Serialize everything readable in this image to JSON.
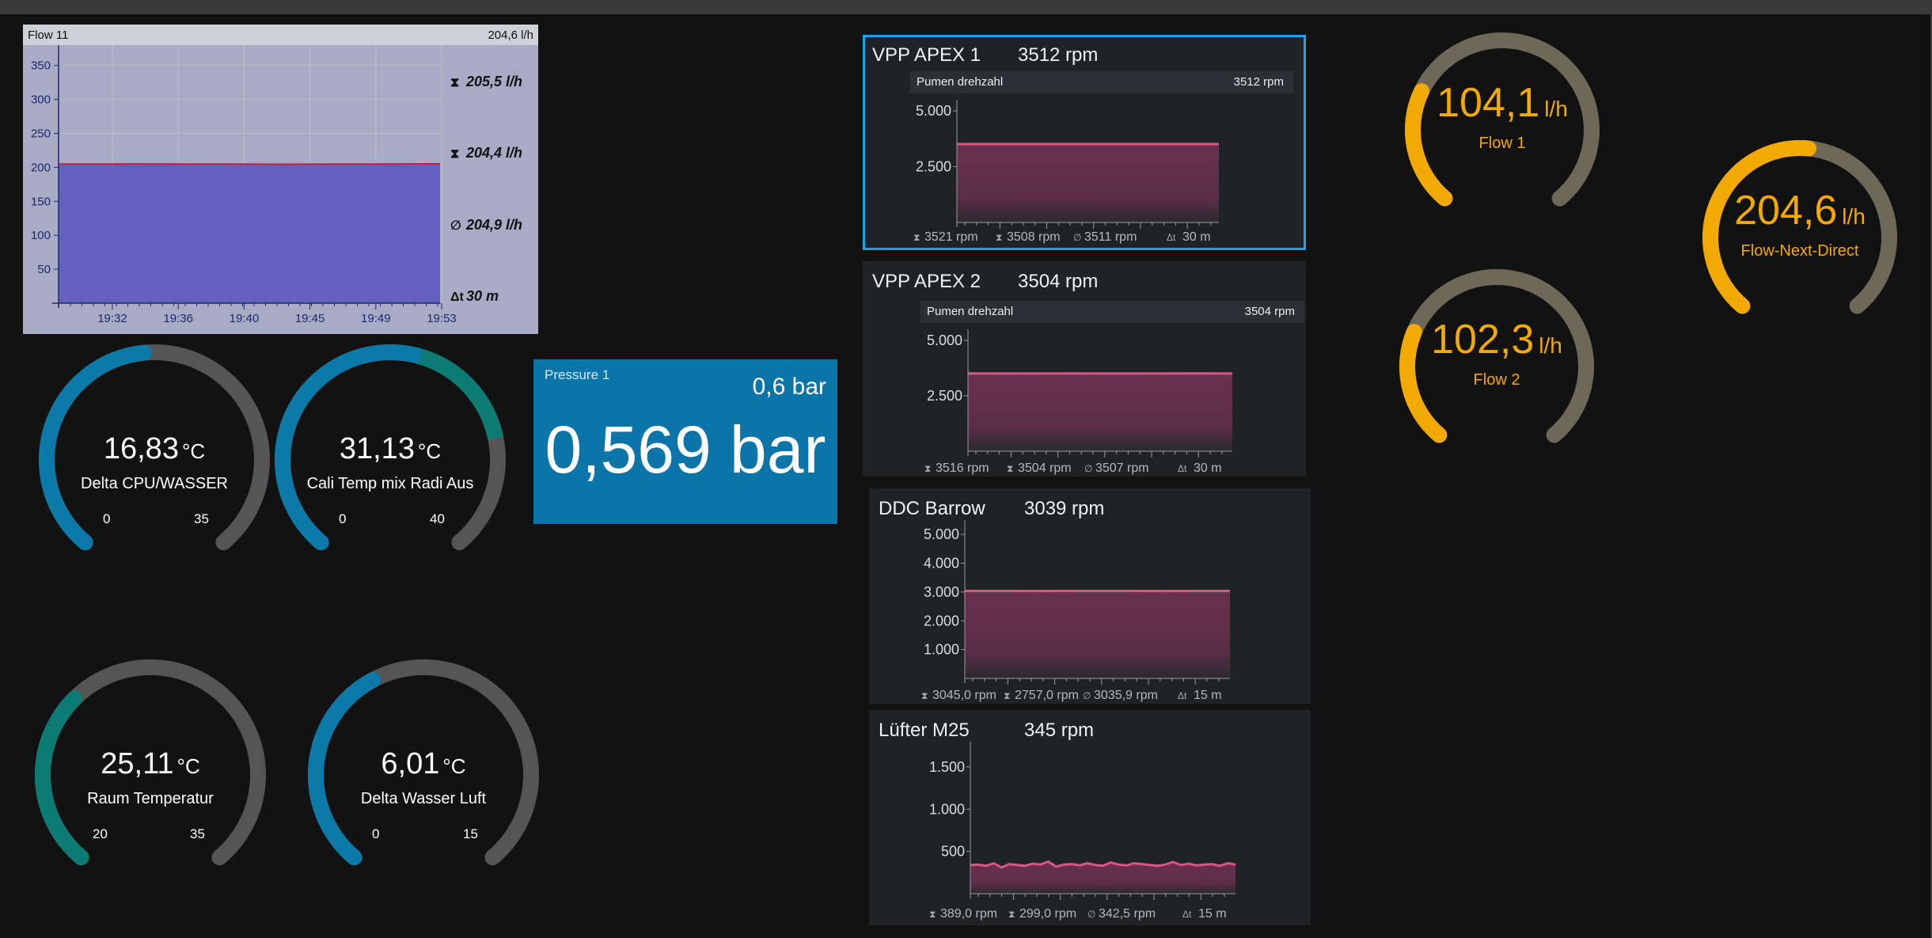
{
  "colors": {
    "background": "#121212",
    "track": "#555555",
    "teal": "#0b7b74",
    "blue": "#0b7aa8",
    "orange": "#f2a900",
    "flow_track": "#6e6858",
    "rpm_line": "#d9577f",
    "selected_outline": "#1aa3e8"
  },
  "flow11": {
    "title": "Flow 11",
    "current": "204,6 l/h",
    "max": "205,5 l/h",
    "min": "204,4 l/h",
    "avg": "204,9 l/h",
    "range": "30 m",
    "stat_icons": [
      "max-arrow-icon",
      "min-arrow-icon",
      "average-icon",
      "delta-time-icon"
    ],
    "chart_data": {
      "type": "area",
      "x": [
        "19:32",
        "19:36",
        "19:40",
        "19:45",
        "19:49",
        "19:53"
      ],
      "values": [
        204.8,
        205.0,
        204.9,
        204.6,
        204.9,
        205.1
      ],
      "yticks": [
        "50",
        "100",
        "150",
        "200",
        "250",
        "300",
        "350"
      ],
      "ylim": [
        0,
        380
      ]
    }
  },
  "gauges": [
    {
      "value": "16,83",
      "unit": "°C",
      "label": "Delta CPU/WASSER",
      "min": "0",
      "max": "35",
      "fraction": 0.48,
      "color": "#0b7aa8"
    },
    {
      "value": "31,13",
      "unit": "°C",
      "label": "Cali  Temp mix Radi Aus",
      "min": "0",
      "max": "40",
      "fraction": 0.78,
      "color": "#0b7aa8",
      "color2": "#0b7b74"
    },
    {
      "value": "25,11",
      "unit": "°C",
      "label": "Raum Temperatur",
      "min": "20",
      "max": "35",
      "fraction": 0.34,
      "color": "#0b7b74"
    },
    {
      "value": "6,01",
      "unit": "°C",
      "label": "Delta Wasser Luft",
      "min": "0",
      "max": "15",
      "fraction": 0.4,
      "color": "#0b7aa8"
    }
  ],
  "pressure": {
    "title": "Pressure 1",
    "setpoint": "0,6 bar",
    "value": "0,569 bar"
  },
  "rpm_panels": [
    {
      "title": "VPP APEX 1",
      "value": "3512 rpm",
      "sub_label": "Pumen drehzahl",
      "sub_value": "3512 rpm",
      "stats": [
        "3521 rpm",
        "3508 rpm",
        "3511 rpm",
        "30 m"
      ],
      "chart_data": {
        "type": "area",
        "yticks": [
          "2.500",
          "5.000"
        ],
        "ylim": [
          0,
          5500
        ],
        "values": [
          3512,
          3512,
          3512,
          3512
        ]
      }
    },
    {
      "title": "VPP APEX 2",
      "value": "3504 rpm",
      "sub_label": "Pumen drehzahl",
      "sub_value": "3504 rpm",
      "stats": [
        "3516 rpm",
        "3504 rpm",
        "3507 rpm",
        "30 m"
      ],
      "chart_data": {
        "type": "area",
        "yticks": [
          "2.500",
          "5.000"
        ],
        "ylim": [
          0,
          5500
        ],
        "values": [
          3507,
          3505,
          3509,
          3504,
          3508,
          3506
        ]
      }
    },
    {
      "title": "DDC Barrow",
      "value": "3039 rpm",
      "stats": [
        "3045,0 rpm",
        "2757,0 rpm",
        "3035,9 rpm",
        "15 m"
      ],
      "chart_data": {
        "type": "area",
        "yticks": [
          "1.000",
          "2.000",
          "3.000",
          "4.000",
          "5.000"
        ],
        "ylim": [
          0,
          5500
        ],
        "values": [
          3039,
          3036,
          3040,
          3035,
          3039
        ]
      }
    },
    {
      "title": "Lüfter M25",
      "value": "345 rpm",
      "stats": [
        "389,0 rpm",
        "299,0 rpm",
        "342,5 rpm",
        "15 m"
      ],
      "chart_data": {
        "type": "area",
        "yticks": [
          "500",
          "1.000",
          "1.500"
        ],
        "ylim": [
          0,
          1800
        ],
        "values": [
          340,
          345,
          330,
          360,
          310,
          350,
          340,
          330,
          355,
          345,
          380,
          320,
          345,
          350,
          335,
          360,
          340,
          330,
          370,
          345,
          335,
          360,
          350,
          340,
          330,
          345,
          375,
          340,
          355,
          335,
          345,
          350,
          330,
          360,
          345
        ]
      }
    }
  ],
  "flow_gauges": [
    {
      "value": "104,1",
      "unit": "l/h",
      "label": "Flow 1",
      "fraction": 0.27
    },
    {
      "value": "102,3",
      "unit": "l/h",
      "label": "Flow 2",
      "fraction": 0.26
    },
    {
      "value": "204,6",
      "unit": "l/h",
      "label": "Flow-Next-Direct",
      "fraction": 0.52
    }
  ]
}
